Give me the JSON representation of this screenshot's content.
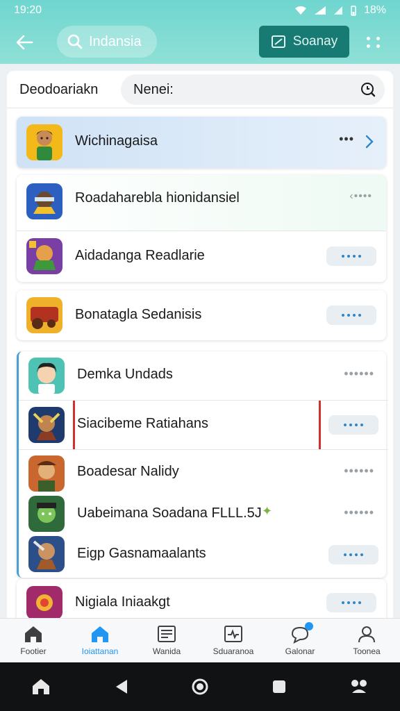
{
  "status_bar": {
    "time": "19:20",
    "battery": "18%"
  },
  "app_bar": {
    "search_label": "Indansia",
    "scan_label": "Soanay"
  },
  "filter": {
    "label": "Deodoariakn",
    "search_value": "Nenei:"
  },
  "rows": [
    {
      "title": "Wichinagaisa",
      "action": "more-chevron"
    },
    {
      "title": "Roadaharebla hionidansiel",
      "action": "dots-plain-arrow"
    },
    {
      "title": "Aidadanga Readlarie",
      "action": "dots-pill"
    },
    {
      "title": "Bonatagla Sedanisis",
      "action": "dots-pill"
    },
    {
      "title": "Demka Undads",
      "action": "dots-plain"
    },
    {
      "title": "Siacibeme Ratiahans",
      "action": "dots-pill"
    },
    {
      "title": "Boadesar Nalidy",
      "action": "dots-plain"
    },
    {
      "title": "Uabeimana Soadana FLLL.5J",
      "action": "dots-plain"
    },
    {
      "title": "Eigp Gasnamaalants",
      "action": "dots-pill"
    },
    {
      "title": "Nigiala Iniaakgt",
      "action": "dots-pill"
    }
  ],
  "bottom_nav": [
    {
      "label": "Footier",
      "icon": "home-icon",
      "active": false
    },
    {
      "label": "Ioiattanan",
      "icon": "home-icon",
      "active": true
    },
    {
      "label": "Wanida",
      "icon": "news-icon",
      "active": false
    },
    {
      "label": "Sduaranoa",
      "icon": "activity-icon",
      "active": false
    },
    {
      "label": "Galonar",
      "icon": "chat-icon",
      "active": false
    },
    {
      "label": "Toonea",
      "icon": "person-icon",
      "active": false
    }
  ],
  "colors": {
    "header": "#7cdad2",
    "scan_button": "#177a73",
    "accent": "#2196f3",
    "highlight_row": "#d8e8f8"
  }
}
